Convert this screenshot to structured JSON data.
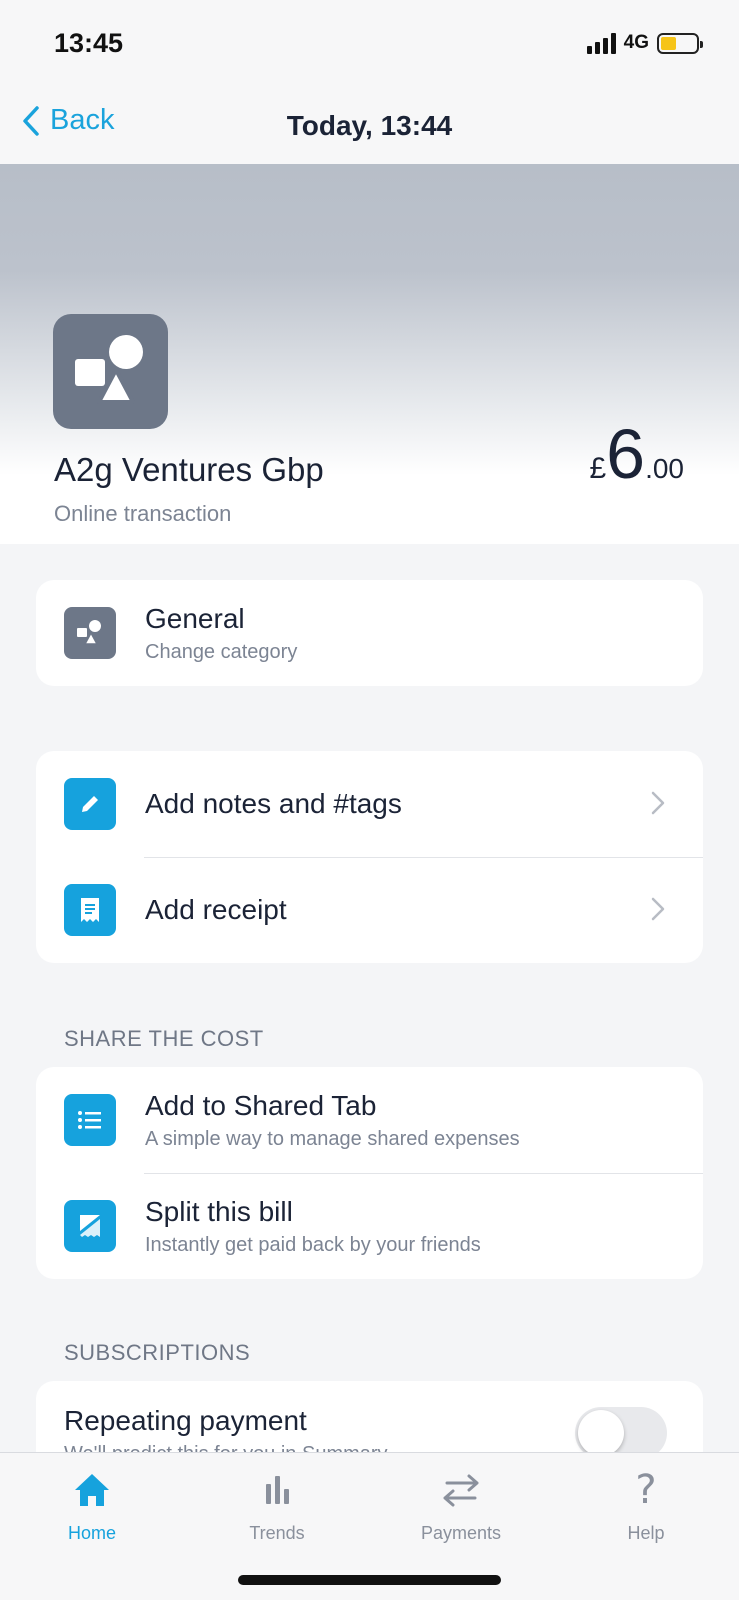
{
  "status_bar": {
    "time": "13:45",
    "network": "4G"
  },
  "nav": {
    "back_label": "Back",
    "title": "Today, 13:44"
  },
  "transaction": {
    "merchant": "A2g Ventures Gbp",
    "subtitle": "Online transaction",
    "currency": "£",
    "amount_major": "6",
    "amount_minor": ".00"
  },
  "category": {
    "title": "General",
    "subtitle": "Change category"
  },
  "actions": [
    {
      "label": "Add notes and #tags",
      "icon": "pencil-icon"
    },
    {
      "label": "Add receipt",
      "icon": "receipt-icon"
    }
  ],
  "share_section": {
    "header": "SHARE THE COST",
    "items": [
      {
        "title": "Add to Shared Tab",
        "subtitle": "A simple way to manage shared expenses",
        "icon": "list-icon"
      },
      {
        "title": "Split this bill",
        "subtitle": "Instantly get paid back by your friends",
        "icon": "split-icon"
      }
    ]
  },
  "subscriptions": {
    "header": "SUBSCRIPTIONS",
    "title": "Repeating payment",
    "subtitle": "We'll predict this for you in Summary",
    "toggle_on": false
  },
  "tabs": [
    {
      "label": "Home",
      "icon": "home-icon",
      "active": true
    },
    {
      "label": "Trends",
      "icon": "trends-icon",
      "active": false
    },
    {
      "label": "Payments",
      "icon": "payments-icon",
      "active": false
    },
    {
      "label": "Help",
      "icon": "help-icon",
      "active": false
    }
  ],
  "colors": {
    "accent": "#16a2dd",
    "category_grey": "#6d7788",
    "battery": "#f6c418"
  }
}
